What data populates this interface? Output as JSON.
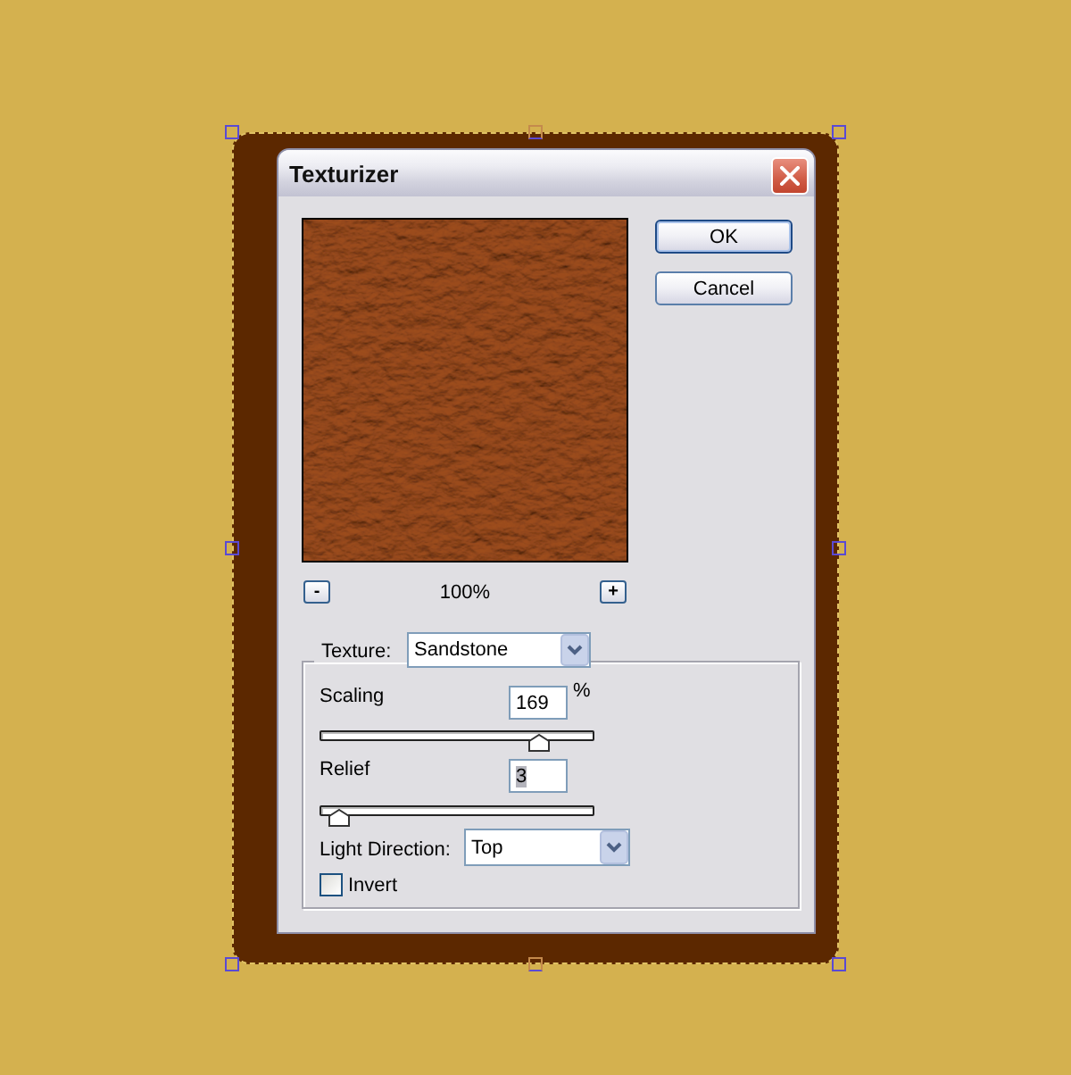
{
  "window": {
    "title": "Texturizer"
  },
  "preview": {
    "zoom_out": "-",
    "zoom_level": "100%",
    "zoom_in": "+"
  },
  "buttons": [
    {
      "label": "OK",
      "default": true
    },
    {
      "label": "Cancel",
      "default": false
    }
  ],
  "texture": {
    "label": "Texture:",
    "value": "Sandstone"
  },
  "sliders": [
    {
      "label": "Scaling",
      "value": "169",
      "unit": "%",
      "text_highlighted": false,
      "level": 0.8
    },
    {
      "label": "Relief",
      "value": "3",
      "text_highlighted": true,
      "level": 0.07
    }
  ],
  "light_direction": {
    "label": "Light Direction:",
    "value": "Top"
  },
  "invert": {
    "label": "Invert",
    "checked": false
  }
}
